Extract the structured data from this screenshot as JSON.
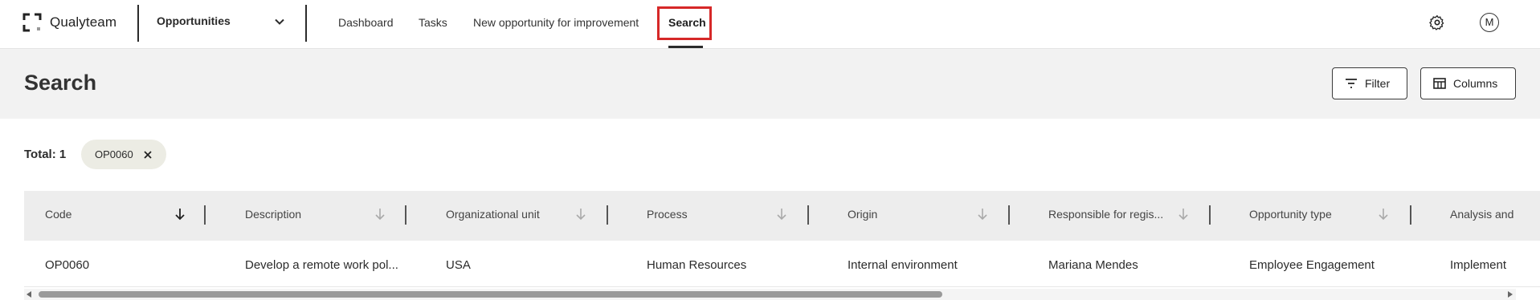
{
  "app": {
    "logo_text": "Qualyteam",
    "module_name": "Opportunities",
    "avatar_initial": "M"
  },
  "nav": {
    "items": [
      "Dashboard",
      "Tasks",
      "New opportunity for improvement",
      "Search"
    ],
    "active": "Search"
  },
  "header": {
    "title": "Search",
    "filter_label": "Filter",
    "columns_label": "Columns"
  },
  "results": {
    "total_label": "Total: 1",
    "chip_label": "OP0060"
  },
  "table": {
    "columns": [
      "Code",
      "Description",
      "Organizational unit",
      "Process",
      "Origin",
      "Responsible for regis...",
      "Opportunity type",
      "Analysis and"
    ],
    "rows": [
      [
        "OP0060",
        "Develop a remote work pol...",
        "USA",
        "Human Resources",
        "Internal environment",
        "Mariana Mendes",
        "Employee Engagement",
        "Implement"
      ]
    ]
  },
  "colors": {
    "highlight": "#d62828",
    "band_bg": "#f2f2f2",
    "chip_bg": "#ecece4"
  }
}
